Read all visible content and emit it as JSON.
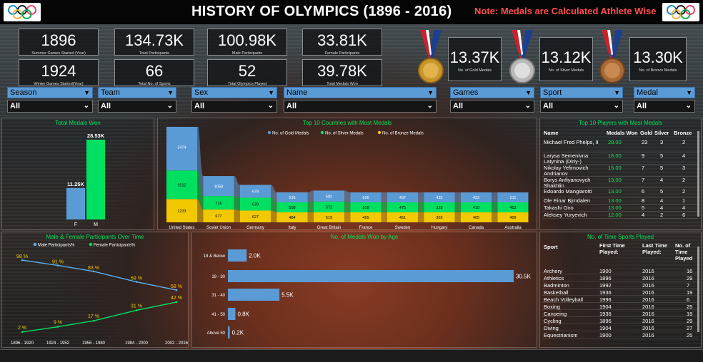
{
  "header": {
    "title": "HISTORY OF OLYMPICS  (1896 - 2016)",
    "note": "Note: Medals are Calculated Athlete Wise",
    "logo_icon": "olympic-rings-icon"
  },
  "kpis": [
    {
      "value": "1896",
      "label": "Summer Games Started (Year)"
    },
    {
      "value": "134.73K",
      "label": "Total Participants"
    },
    {
      "value": "100.98K",
      "label": "Male Participants"
    },
    {
      "value": "33.81K",
      "label": "Female Participants"
    },
    {
      "value": "1924",
      "label": "Winter Games Started(Year)"
    },
    {
      "value": "66",
      "label": "Total No. of Sports"
    },
    {
      "value": "52",
      "label": "Total Olympics Played"
    },
    {
      "value": "39.78K",
      "label": "Total Medals Won"
    }
  ],
  "medals": [
    {
      "value": "13.37K",
      "label": "No. of Gold Medals",
      "icon": "gold-medal-icon",
      "color": "#d9a83a"
    },
    {
      "value": "13.12K",
      "label": "No. of Silver Medals",
      "icon": "silver-medal-icon",
      "color": "#c9c9c9"
    },
    {
      "value": "13.30K",
      "label": "No. of Bronze Medals",
      "icon": "bronze-medal-icon",
      "color": "#b87a45"
    }
  ],
  "slicers": [
    {
      "label": "Season",
      "value": "All"
    },
    {
      "label": "Team",
      "value": "All"
    },
    {
      "label": "Sex",
      "value": "All"
    },
    {
      "label": "Name",
      "value": "All"
    },
    {
      "label": "Games",
      "value": "All"
    },
    {
      "label": "Sport",
      "value": "All"
    },
    {
      "label": "Medal",
      "value": "All"
    }
  ],
  "colors": {
    "accent_green": "#00e25b",
    "blue": "#5b9bd5",
    "green": "#00e060",
    "yellow": "#f2c800",
    "highlight_green": "#14e84f"
  },
  "chart_data": [
    {
      "id": "total-medals",
      "type": "bar",
      "title": "Total Medals Won",
      "categories": [
        "F",
        "M"
      ],
      "values": [
        11.25,
        28.53
      ],
      "value_labels": [
        "11.25K",
        "28.53K"
      ]
    },
    {
      "id": "top-countries",
      "type": "bar",
      "title": "Top 10 Countries with Most Medals",
      "legend": [
        "No. of Gold Medals",
        "No. of  Silver Medals",
        "No. of Bronze Medals"
      ],
      "categories": [
        "United States",
        "Soviet Union",
        "Germany",
        "Italy",
        "Great Britain",
        "France",
        "Sweden",
        "Hungary",
        "Canada",
        "Australia"
      ],
      "series": [
        {
          "name": "No. of Gold Medals",
          "values": [
            2474,
            1058,
            679,
            535,
            582,
            526,
            497,
            432,
            422,
            511
          ]
        },
        {
          "name": "No. of  Silver Medals",
          "values": [
            1512,
            716,
            678,
            508,
            572,
            518,
            475,
            328,
            410,
            453
          ]
        },
        {
          "name": "No. of Bronze Medals",
          "values": [
            1233,
            677,
            627,
            484,
            519,
            455,
            451,
            365,
            405,
            409
          ]
        }
      ]
    },
    {
      "id": "participants-over-time",
      "type": "line",
      "title": "Male & Female Participants Over Time",
      "legend": [
        "Male Participants%",
        "Female Participants%"
      ],
      "categories": [
        "1896 - 1920",
        "1924 - 1952",
        "1956 - 1980",
        "1984 - 2000",
        "2002 - 2016"
      ],
      "series": [
        {
          "name": "Male Participants%",
          "values": [
            98,
            91,
            83,
            69,
            58
          ],
          "labels": [
            "98 %",
            "91 %",
            "83 %",
            "69 %",
            "58 %"
          ]
        },
        {
          "name": "Female Participants%",
          "values": [
            2,
            9,
            17,
            31,
            42
          ],
          "labels": [
            "2 %",
            "9 %",
            "17 %",
            "31 %",
            "42 %"
          ]
        }
      ]
    },
    {
      "id": "medals-by-age",
      "type": "bar",
      "title": "No. of Medals Won by Age",
      "categories": [
        "18 & Below",
        "19 - 30",
        "31 - 40",
        "41 - 50",
        "Above 50"
      ],
      "values": [
        2.0,
        30.5,
        5.5,
        0.8,
        0.2
      ],
      "value_labels": [
        "2.0K",
        "30.5K",
        "5.5K",
        "0.8K",
        "0.2K"
      ]
    }
  ],
  "players_table": {
    "title": "Top 10 Players with Most Medals",
    "columns": [
      "Name",
      "Medals Won",
      "Gold",
      "Silver",
      "Bronze"
    ],
    "rows": [
      {
        "name": "Michael Fred Phelps, II",
        "won": "28.00",
        "gold": "23",
        "silver": "3",
        "bronze": "2"
      },
      {
        "name": "Larysa Semenivna Latynina (Diriy-)",
        "won": "18.00",
        "gold": "9",
        "silver": "5",
        "bronze": "4"
      },
      {
        "name": "Nikolay Yefimovich Andrianov",
        "won": "15.00",
        "gold": "7",
        "silver": "5",
        "bronze": "3"
      },
      {
        "name": "Borys Anfiyanovych Shakhlin",
        "won": "13.00",
        "gold": "7",
        "silver": "4",
        "bronze": "2"
      },
      {
        "name": "Edoardo Mangiarotti",
        "won": "13.00",
        "gold": "6",
        "silver": "5",
        "bronze": "2"
      },
      {
        "name": "Ole Einar Bjrndalen",
        "won": "13.00",
        "gold": "8",
        "silver": "4",
        "bronze": "1"
      },
      {
        "name": "Takashi Ono",
        "won": "13.00",
        "gold": "5",
        "silver": "4",
        "bronze": "4"
      },
      {
        "name": "Aleksey Yuryevich",
        "won": "12.00",
        "gold": "4",
        "silver": "2",
        "bronze": "6"
      }
    ]
  },
  "sports_table": {
    "title": "No. of Time Sports Played",
    "columns": [
      "Sport",
      "First Time Played:",
      "Last Time Played:",
      "No. of Time Played"
    ],
    "rows": [
      {
        "sport": "Archery",
        "first": "1900",
        "last": "2016",
        "count": "16"
      },
      {
        "sport": "Athletics",
        "first": "1896",
        "last": "2016",
        "count": "29"
      },
      {
        "sport": "Badminton",
        "first": "1992",
        "last": "2016",
        "count": "7"
      },
      {
        "sport": "Basketball",
        "first": "1936",
        "last": "2016",
        "count": "19"
      },
      {
        "sport": "Beach Volleyball",
        "first": "1996",
        "last": "2016",
        "count": "6"
      },
      {
        "sport": "Boxing",
        "first": "1904",
        "last": "2016",
        "count": "25"
      },
      {
        "sport": "Canoeing",
        "first": "1936",
        "last": "2016",
        "count": "19"
      },
      {
        "sport": "Cycling",
        "first": "1896",
        "last": "2016",
        "count": "29"
      },
      {
        "sport": "Diving",
        "first": "1904",
        "last": "2016",
        "count": "27"
      },
      {
        "sport": "Equestrianism",
        "first": "1900",
        "last": "2016",
        "count": "25"
      }
    ]
  }
}
